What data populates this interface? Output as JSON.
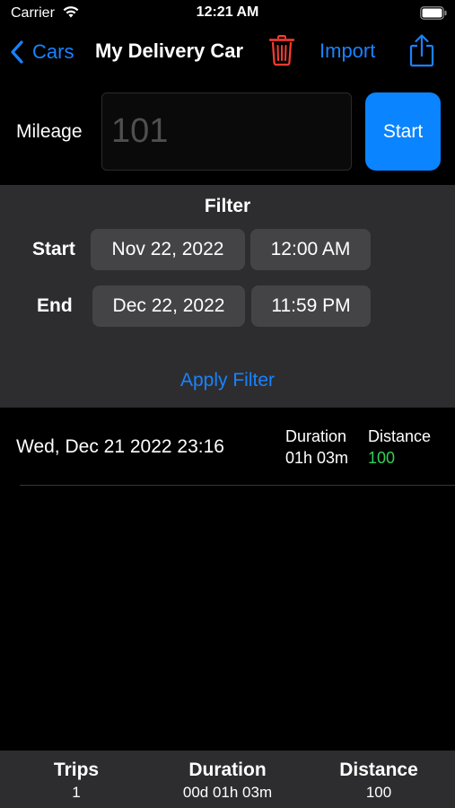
{
  "status_bar": {
    "carrier": "Carrier",
    "time": "12:21 AM"
  },
  "nav": {
    "back_label": "Cars",
    "title": "My Delivery Car",
    "import_label": "Import"
  },
  "mileage": {
    "label": "Mileage",
    "placeholder": "101",
    "start_label": "Start"
  },
  "filter": {
    "title": "Filter",
    "start_label": "Start",
    "start_date": "Nov 22, 2022",
    "start_time": "12:00 AM",
    "end_label": "End",
    "end_date": "Dec 22, 2022",
    "end_time": "11:59 PM",
    "apply_label": "Apply Filter"
  },
  "trips": [
    {
      "date": "Wed, Dec 21 2022 23:16",
      "duration_label": "Duration",
      "duration": "01h 03m",
      "distance_label": "Distance",
      "distance": "100"
    }
  ],
  "summary": {
    "trips_label": "Trips",
    "trips_value": "1",
    "duration_label": "Duration",
    "duration_value": "00d 01h 03m",
    "distance_label": "Distance",
    "distance_value": "100"
  },
  "colors": {
    "accent": "#0a84ff",
    "destructive": "#ff3b30",
    "distance": "#30d158",
    "panel": "#2d2d2f"
  },
  "icons": [
    "wifi-icon",
    "battery-icon",
    "chevron-left-icon",
    "trash-icon",
    "share-icon"
  ]
}
